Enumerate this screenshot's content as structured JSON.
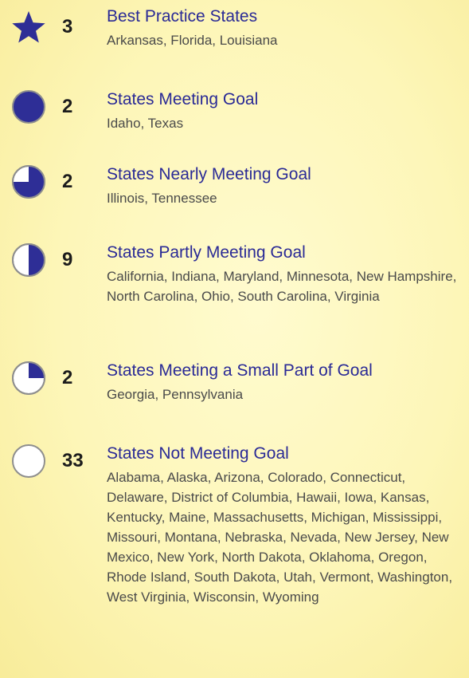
{
  "colors": {
    "fill": "#2e2e96",
    "ring": "#8e8e8e",
    "title": "#2a2a96",
    "states": "#4a4a4a"
  },
  "categories": [
    {
      "icon": "star-icon",
      "level": "star",
      "count": "3",
      "title": "Best Practice States",
      "states": "Arkansas, Florida, Louisiana"
    },
    {
      "icon": "full-circle-icon",
      "level": 1.0,
      "count": "2",
      "title": "States Meeting Goal",
      "states": "Idaho, Texas"
    },
    {
      "icon": "three-quarter-circle-icon",
      "level": 0.75,
      "count": "2",
      "title": "States Nearly Meeting Goal",
      "states": "Illinois, Tennessee"
    },
    {
      "icon": "half-circle-icon",
      "level": 0.5,
      "count": "9",
      "title": "States Partly Meeting Goal",
      "states": "California, Indiana, Maryland, Minnesota, New Hampshire, North Carolina, Ohio, South Carolina, Virginia"
    },
    {
      "icon": "quarter-circle-icon",
      "level": 0.25,
      "count": "2",
      "title": "States Meeting a Small Part of Goal",
      "states": "Georgia, Pennsylvania"
    },
    {
      "icon": "empty-circle-icon",
      "level": 0,
      "count": "33",
      "title": "States Not Meeting Goal",
      "states": "Alabama, Alaska, Arizona, Colorado, Connecticut, Delaware, District of Columbia, Hawaii, Iowa, Kansas, Kentucky, Maine, Massachusetts, Michigan, Mississippi, Missouri, Montana, Nebraska, Nevada, New Jersey, New Mexico, New York, North Dakota, Oklahoma, Oregon, Rhode Island, South Dakota, Utah, Vermont, Washington, West Virginia, Wisconsin, Wyoming"
    }
  ]
}
